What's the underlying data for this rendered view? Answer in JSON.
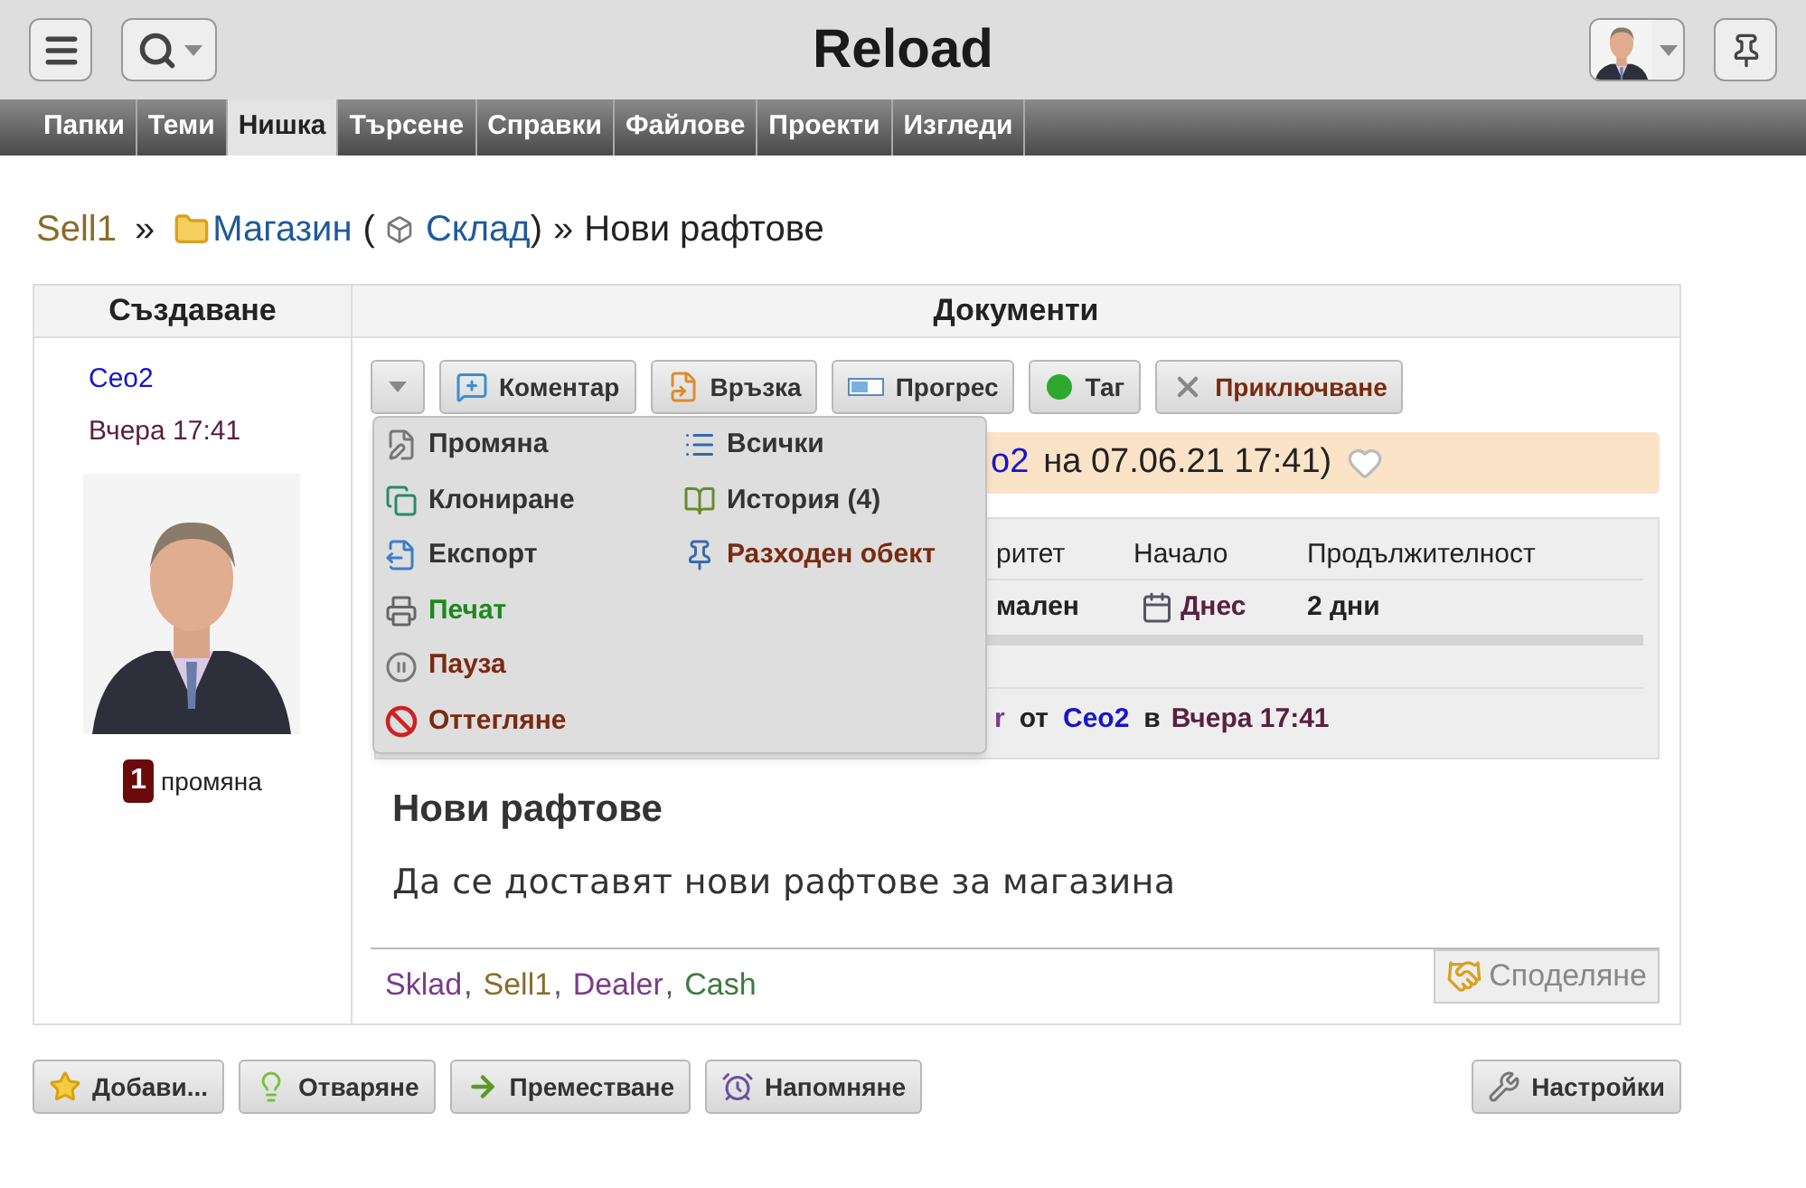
{
  "header": {
    "title": "Reload"
  },
  "tabs": [
    {
      "label": "Папки",
      "selected": false
    },
    {
      "label": "Теми",
      "selected": false
    },
    {
      "label": "Нишка",
      "selected": true
    },
    {
      "label": "Търсене",
      "selected": false
    },
    {
      "label": "Справки",
      "selected": false
    },
    {
      "label": "Файлове",
      "selected": false
    },
    {
      "label": "Проекти",
      "selected": false
    },
    {
      "label": "Изгледи",
      "selected": false
    }
  ],
  "breadcrumb": {
    "root": "Sell1",
    "sep1": "»",
    "folder": "Магазин",
    "open_paren": "(",
    "linked": "Склад",
    "close_paren": ")",
    "sep2": "»",
    "current": "Нови рафтове"
  },
  "creator": {
    "heading": "Създаване",
    "author": "Ceo2",
    "time": "Вчера 17:41",
    "changes_count": "1",
    "changes_label": "промяна"
  },
  "documents": {
    "heading": "Документи",
    "toolbar": [
      {
        "kind": "comment",
        "label": "Коментар",
        "color": "#333333"
      },
      {
        "kind": "link",
        "label": "Връзка",
        "color": "#333333"
      },
      {
        "kind": "progress",
        "label": "Прогрес",
        "color": "#333333"
      },
      {
        "kind": "tag",
        "label": "Таг",
        "color": "#333333"
      },
      {
        "kind": "close",
        "label": "Приключване",
        "color": "#7a2a10"
      }
    ],
    "banner": {
      "author_fragment": "o2",
      "text": "на 07.06.21 17:41)"
    },
    "table": {
      "columns": [
        "ритет",
        "Начало",
        "Продължителност"
      ],
      "row": [
        "мален",
        "Днес",
        "2 дни"
      ]
    },
    "footer_line": {
      "fragment": "r",
      "by": "от",
      "author": "Ceo2",
      "at": "в",
      "time": "Вчера 17:41"
    },
    "title": "Нови рафтове",
    "description": "Да се доставят нови рафтове за магазина",
    "tags": [
      {
        "label": "Sklad",
        "color": "#7b3a8c",
        "separator": ","
      },
      {
        "label": "Sell1",
        "color": "#8b6a2a",
        "separator": ","
      },
      {
        "label": "Dealer",
        "color": "#7b3a8c",
        "separator": ","
      },
      {
        "label": "Cash",
        "color": "#3f7a3f"
      }
    ],
    "share": "Споделяне"
  },
  "menu": {
    "expanded": true,
    "left_items": [
      {
        "kind": "edit",
        "label": "Промяна",
        "color": "#333333"
      },
      {
        "kind": "clone",
        "label": "Клониране",
        "color": "#333333"
      },
      {
        "kind": "export",
        "label": "Експорт",
        "color": "#333333"
      },
      {
        "kind": "print",
        "label": "Печат",
        "color": "#1a8a1a"
      },
      {
        "kind": "pause",
        "label": "Пауза",
        "color": "#7a2a10"
      },
      {
        "kind": "withdraw",
        "label": "Оттегляне",
        "color": "#7a2a10"
      }
    ],
    "right_items": [
      {
        "kind": "list",
        "label": "Всички",
        "color": "#333333"
      },
      {
        "kind": "history",
        "label": "История (4)",
        "color": "#333333"
      },
      {
        "kind": "pin",
        "label": "Разходен обект",
        "color": "#7a2a10"
      }
    ]
  },
  "actions": [
    {
      "kind": "star",
      "label": "Добави..."
    },
    {
      "kind": "bulb",
      "label": "Отваряне"
    },
    {
      "kind": "move",
      "label": "Преместване"
    },
    {
      "kind": "alarm",
      "label": "Напомняне"
    }
  ],
  "settings": {
    "label": "Настройки"
  }
}
